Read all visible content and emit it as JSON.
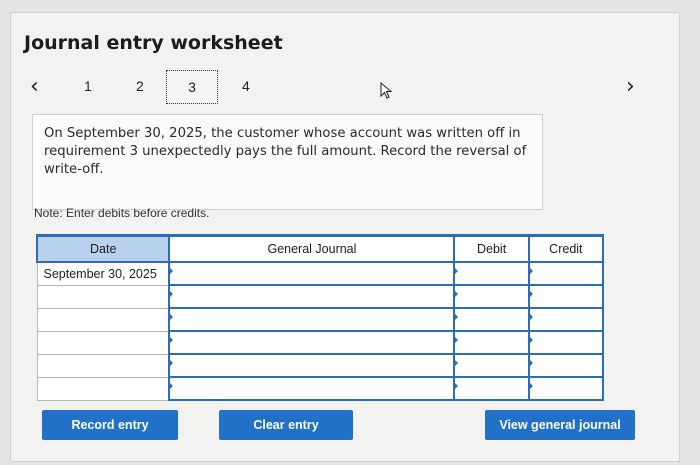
{
  "page": {
    "title": "Journal entry worksheet"
  },
  "pager": {
    "prev_icon": "chevron-left-icon",
    "next_icon": "chevron-right-icon",
    "steps": [
      "1",
      "2",
      "3",
      "4"
    ],
    "active_step": "3"
  },
  "question": {
    "text": "On September 30, 2025, the customer whose account was written off in requirement 3 unexpectedly pays the full amount. Record the reversal of write-off."
  },
  "note": {
    "text": "Note: Enter debits before credits."
  },
  "table": {
    "headers": {
      "date": "Date",
      "journal": "General Journal",
      "debit": "Debit",
      "credit": "Credit"
    },
    "rows": [
      {
        "date": "September 30, 2025",
        "journal": "",
        "debit": "",
        "credit": ""
      },
      {
        "date": "",
        "journal": "",
        "debit": "",
        "credit": ""
      },
      {
        "date": "",
        "journal": "",
        "debit": "",
        "credit": ""
      },
      {
        "date": "",
        "journal": "",
        "debit": "",
        "credit": ""
      },
      {
        "date": "",
        "journal": "",
        "debit": "",
        "credit": ""
      },
      {
        "date": "",
        "journal": "",
        "debit": "",
        "credit": ""
      }
    ]
  },
  "buttons": {
    "record": "Record entry",
    "clear": "Clear entry",
    "view": "View general journal"
  },
  "colors": {
    "accent": "#2171c8",
    "date_header": "#b8d2ee"
  }
}
